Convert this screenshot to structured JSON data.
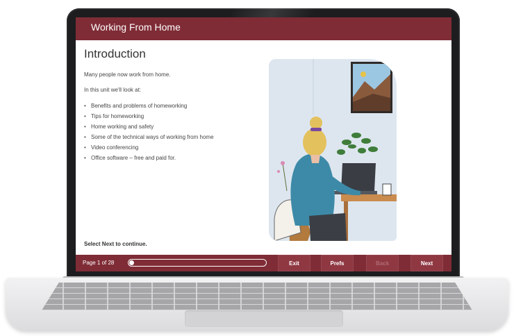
{
  "course": {
    "title": "Working From Home",
    "heading": "Introduction",
    "paragraphs": [
      "Many people now work from home.",
      "In this unit we'll look at:"
    ],
    "topics": [
      "Benefits and problems of homeworking",
      "Tips for homeworking",
      "Home working and safety",
      "Some of the technical ways of working from home",
      "Video conferencing",
      "Office software – free and paid for."
    ],
    "instruction": "Select Next to continue.",
    "illustration": "woman-working-at-laptop-illustration"
  },
  "nav": {
    "page_label": "Page 1 of 28",
    "progress": 0.036,
    "exit": "Exit",
    "prefs": "Prefs",
    "back": "Back",
    "next": "Next"
  },
  "colors": {
    "brand": "#7f2c36",
    "button": "#8f3842",
    "disabled_text": "#b06a73"
  }
}
